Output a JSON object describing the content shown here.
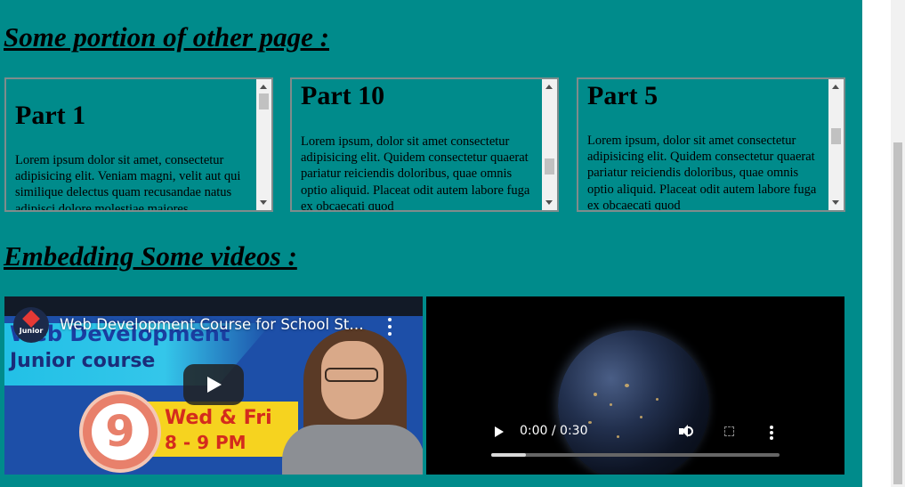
{
  "headings": {
    "other_page": "Some portion of other page :",
    "videos": "Embedding Some videos :"
  },
  "parts": [
    {
      "title": "Part 1",
      "text": "Lorem ipsum dolor sit amet, consectetur adipisicing elit. Veniam magni, velit aut qui similique delectus quam recusandae natus adipisci dolore molestiae maiores",
      "scroll_fraction": 0.0
    },
    {
      "title": "Part 10",
      "text": "Lorem ipsum, dolor sit amet consectetur adipisicing elit. Quidem consectetur quaerat pariatur reiciendis doloribus, quae omnis optio aliquid. Placeat odit autem labore fuga ex obcaecati quod",
      "scroll_fraction": 0.75
    },
    {
      "title": "Part 5",
      "text": "Lorem ipsum, dolor sit amet consectetur adipisicing elit. Quidem consectetur quaerat pariatur reiciendis doloribus, quae omnis optio aliquid. Placeat odit autem labore fuga ex obcaecati quod",
      "scroll_fraction": 0.4
    }
  ],
  "youtube": {
    "title": "Web Development Course for School Students | Junior Course",
    "channel_logo_text": "Junior",
    "thumbnail": {
      "line1": "Web Development",
      "line2": "Junior course",
      "number": "9",
      "days": "Wed & Fri",
      "time": "8 - 9 PM"
    }
  },
  "video_player": {
    "time_display": "0:00 / 0:30",
    "progress_fraction": 0.12
  },
  "colors": {
    "page_background": "#008b8b",
    "heading_text": "#000000"
  }
}
